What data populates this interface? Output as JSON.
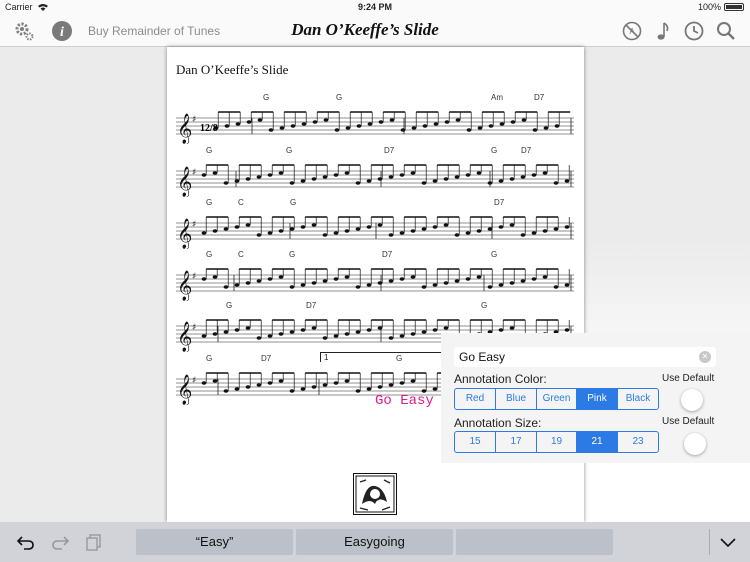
{
  "status_bar": {
    "carrier": "Carrier",
    "time": "9:24 PM",
    "battery": "100%"
  },
  "toolbar": {
    "buy_label": "Buy Remainder of Tunes",
    "title": "Dan O’Keeffe’s Slide",
    "left_icons": [
      "gear-icon",
      "info-icon"
    ],
    "right_icons": [
      "no-annotation-icon",
      "music-note-icon",
      "clock-icon",
      "search-icon"
    ]
  },
  "score": {
    "title": "Dan O’Keeffe’s Slide",
    "time_signature": "12/8",
    "systems": [
      {
        "chords": [
          "G",
          "G",
          "Am",
          "D7"
        ]
      },
      {
        "chords": [
          "G",
          "G",
          "D7",
          "G",
          "D7"
        ]
      },
      {
        "chords": [
          "G",
          "C",
          "G",
          "D7"
        ]
      },
      {
        "chords": [
          "G",
          "C",
          "G",
          "D7",
          "G"
        ]
      },
      {
        "chords": [
          "G",
          "D7",
          "G"
        ]
      },
      {
        "chords": [
          "G",
          "D7",
          "G"
        ],
        "ending": "1"
      }
    ],
    "annotation_text": "Go Easy"
  },
  "annotation_panel": {
    "text_value": "Go Easy",
    "color_label": "Annotation Color:",
    "use_default_label": "Use Default",
    "colors": [
      "Red",
      "Blue",
      "Green",
      "Pink",
      "Black"
    ],
    "selected_color": "Pink",
    "size_label": "Annotation Size:",
    "sizes": [
      "15",
      "17",
      "19",
      "21",
      "23"
    ],
    "selected_size": "21",
    "accent_color": "#2c7be5",
    "annotation_color": "#e0188a"
  },
  "bottom_bar": {
    "suggestions": [
      "“Easy”",
      "Easygoing",
      ""
    ],
    "icons": [
      "undo-icon",
      "redo-icon",
      "paste-icon",
      "chevron-down-icon"
    ]
  }
}
